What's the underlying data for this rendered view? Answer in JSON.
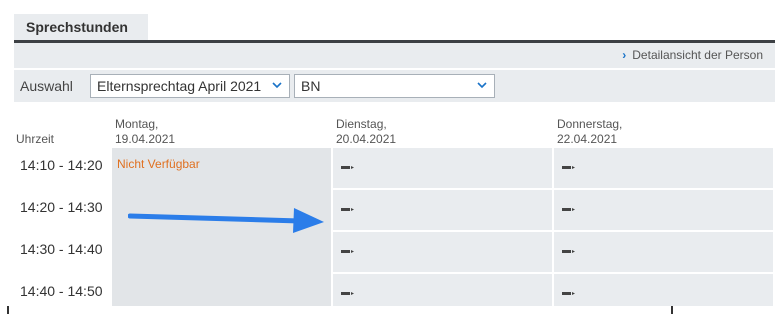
{
  "tab": {
    "title": "Sprechstunden"
  },
  "detail": {
    "link_label": "Detailansicht der Person"
  },
  "selection": {
    "label": "Auswahl",
    "event_value": "Elternsprechtag April 2021",
    "person_value": "BN"
  },
  "columns": {
    "time_header": "Uhrzeit",
    "days": [
      {
        "weekday": "Montag,",
        "date": "19.04.2021"
      },
      {
        "weekday": "Dienstag,",
        "date": "20.04.2021"
      },
      {
        "weekday": "Donnerstag,",
        "date": "22.04.2021"
      }
    ]
  },
  "rows": [
    {
      "time": "14:10 - 14:20"
    },
    {
      "time": "14:20 - 14:30"
    },
    {
      "time": "14:30 - 14:40"
    },
    {
      "time": "14:40 - 14:50"
    }
  ],
  "monday_status": "Nicht Verfügbar",
  "colors": {
    "accent": "#1a73c8",
    "unavailable_text": "#e07020",
    "arrow": "#2b7de9"
  },
  "icons": {
    "slot_marker": "slot-marker-icon",
    "dropdown": "chevron-down-icon",
    "link": "chevron-right-icon"
  }
}
